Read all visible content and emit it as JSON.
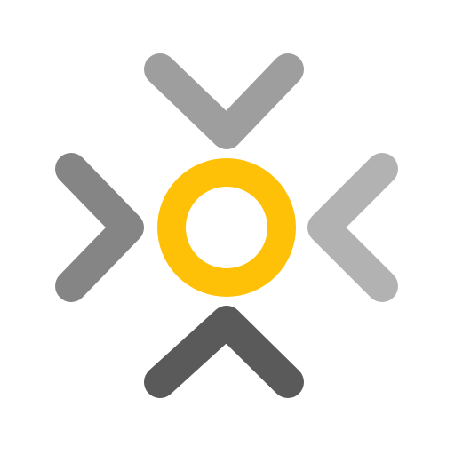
{
  "logo": {
    "icon": "focus-target-icon",
    "colors": {
      "background": "#ffffff",
      "ring": "#FFC107",
      "chevron_top": "#9E9E9E",
      "chevron_left": "#858585",
      "chevron_right": "#B2B2B2",
      "chevron_bottom": "#5A5A5A"
    }
  }
}
